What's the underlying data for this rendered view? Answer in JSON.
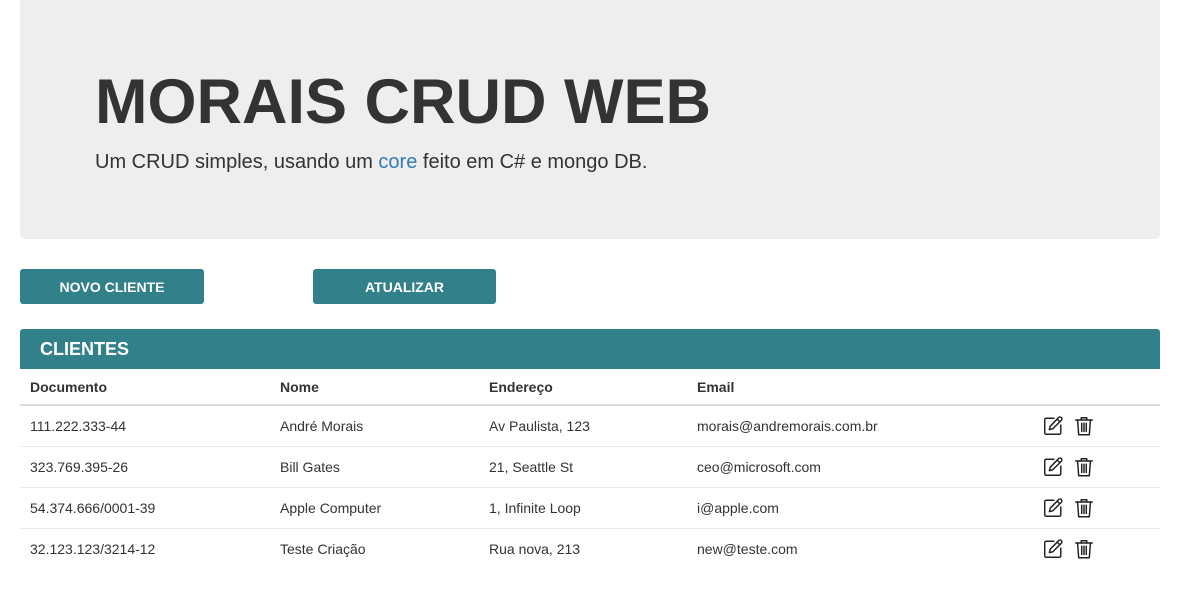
{
  "header": {
    "title": "MORAIS CRUD WEB",
    "subtitle_before": "Um CRUD simples, usando um ",
    "subtitle_link": "core",
    "subtitle_after": " feito em C# e mongo DB."
  },
  "toolbar": {
    "new_label": "NOVO CLIENTE",
    "refresh_label": "ATUALIZAR"
  },
  "panel": {
    "title": "CLIENTES"
  },
  "table": {
    "columns": [
      "Documento",
      "Nome",
      "Endereço",
      "Email"
    ],
    "rows": [
      {
        "documento": "111.222.333-44",
        "nome": "André Morais",
        "endereco": "Av Paulista, 123",
        "email": "morais@andremorais.com.br"
      },
      {
        "documento": "323.769.395-26",
        "nome": "Bill Gates",
        "endereco": "21, Seattle St",
        "email": "ceo@microsoft.com"
      },
      {
        "documento": "54.374.666/0001-39",
        "nome": "Apple Computer",
        "endereco": "1, Infinite Loop",
        "email": "i@apple.com"
      },
      {
        "documento": "32.123.123/3214-12",
        "nome": "Teste Criação",
        "endereco": "Rua nova, 213",
        "email": "new@teste.com"
      }
    ]
  },
  "icons": {
    "edit": "edit-icon",
    "delete": "trash-icon"
  },
  "colors": {
    "accent": "#31808a",
    "jumbotron_bg": "#eeeeee",
    "link": "#337ab7"
  }
}
